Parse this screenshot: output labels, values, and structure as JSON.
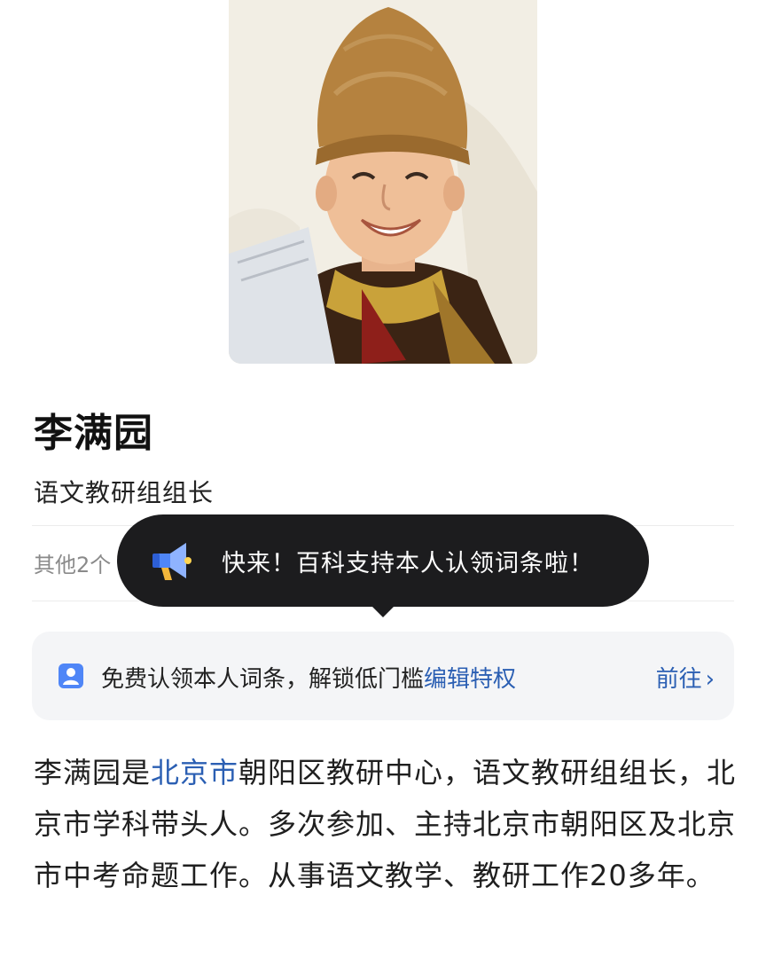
{
  "profile": {
    "name": "李满园",
    "subtitle": "语文教研组组长",
    "other_text": "其他2个"
  },
  "tooltip": {
    "icon": "megaphone-icon",
    "text": "快来！百科支持本人认领词条啦！"
  },
  "claim": {
    "icon": "person-card-icon",
    "text": "免费认领本人词条，解锁低门槛",
    "link": "编辑特权",
    "action": "前往",
    "action_icon": "chevron-right-icon"
  },
  "intro": {
    "part1": "李满园是",
    "link": "北京市",
    "part2": "朝阳区教研中心，语文教研组组长，北京市学科带头人。多次参加、主持北京市朝阳区及北京市中考命题工作。从事语文教学、教研工作20多年。"
  },
  "colors": {
    "link": "#2b5fb3",
    "tooltip_bg": "#1c1c1e",
    "banner_bg": "#f4f5f7"
  }
}
